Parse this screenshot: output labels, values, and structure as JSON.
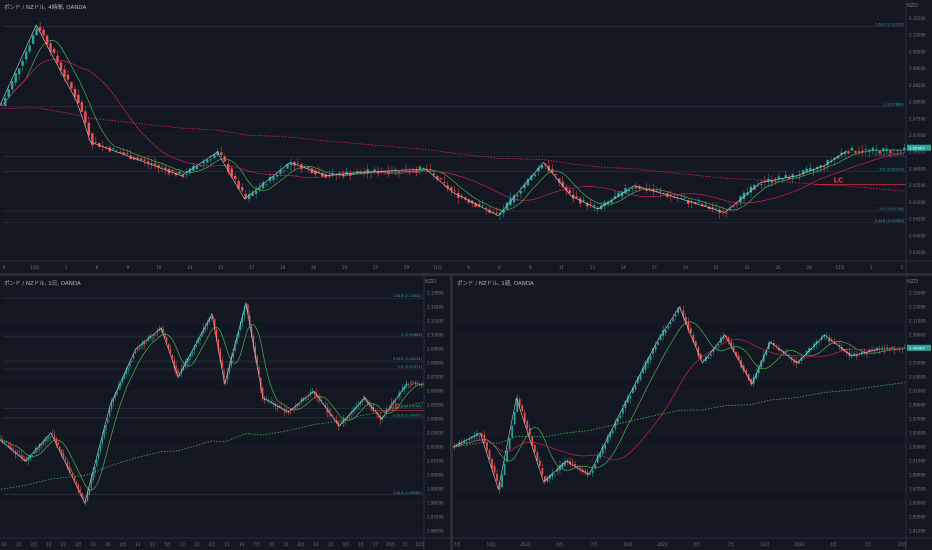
{
  "panes": {
    "top": {
      "title": "ポンド / NZドル, 4時間, OANDA"
    },
    "bl": {
      "title": "ポンド / NZドル, 1日, OANDA"
    },
    "br": {
      "title": "ポンド / NZドル, 1週, OANDA"
    }
  },
  "badge": "NZD",
  "colors": {
    "bg": "#131722",
    "grid": "#1f2430",
    "up": "#26a69a",
    "down": "#ef5350",
    "ma_fast": "#4caf50",
    "ma_slow": "#e91e63",
    "zigzag": "#c9c9c9",
    "lc": "#f23645"
  },
  "chart_data": [
    {
      "type": "candlestick",
      "title": "ポンド / NZドル, 4時間, OANDA",
      "price_labels": [
        "2.10500",
        "2.10000",
        "2.09500",
        "2.09000",
        "2.08500",
        "2.08000",
        "2.07500",
        "2.07000",
        "2.06500",
        "2.06000",
        "2.05500",
        "2.05000",
        "2.04500",
        "2.04000",
        "2.03500"
      ],
      "fib_levels": [
        {
          "label": "1.618 (2.10258)",
          "value": 2.10258
        },
        {
          "label": "1 (2.07866)",
          "value": 2.07866
        },
        {
          "label": "0.618 (2.06378)",
          "value": 2.06378
        },
        {
          "label": "0.5 (2.05919)",
          "value": 2.05919
        },
        {
          "label": "0.5 (2.04744)",
          "value": 2.04744
        },
        {
          "label": "0.618 (2.04390)",
          "value": 2.0439
        }
      ],
      "current_price": "2.05963",
      "annotation": "LC",
      "x_ticks": [
        "9",
        "10月",
        "3",
        "6",
        "9",
        "10",
        "13",
        "15",
        "17",
        "18",
        "20",
        "24",
        "27",
        "29",
        "11月",
        "4",
        "6",
        "8",
        "11",
        "13",
        "14",
        "17",
        "19",
        "21",
        "22",
        "26",
        "28",
        "12月",
        "3",
        "5"
      ]
    },
    {
      "type": "candlestick",
      "title": "ポンド / NZドル, 1日, OANDA",
      "price_labels": [
        "2.13000",
        "2.12000",
        "2.11000",
        "2.10000",
        "2.09000",
        "2.08000",
        "2.07000",
        "2.06000",
        "2.05000",
        "2.04000",
        "2.03000",
        "2.02000",
        "2.01000",
        "2.00000",
        "1.99000",
        "1.98000",
        "1.97000",
        "1.96000"
      ],
      "fib_levels": [
        {
          "label": "1.618 (2.12632)",
          "value": 2.12632
        },
        {
          "label": "1 (2.09863)",
          "value": 2.09863
        },
        {
          "label": "0.618 (2.08134)",
          "value": 2.08134
        },
        {
          "label": "0.5 (2.07571)",
          "value": 2.07571
        },
        {
          "label": "0.5 (2.04746)",
          "value": 2.04746
        },
        {
          "label": "0.618 (2.04095)",
          "value": 2.04095
        },
        {
          "label": "1.618 (1.98589)",
          "value": 1.98589
        }
      ],
      "annotation": "LC",
      "x_ticks": [
        "16",
        "22",
        "2月",
        "13",
        "22",
        "3月",
        "13",
        "24",
        "4月",
        "13",
        "22",
        "5月",
        "13",
        "22",
        "6月",
        "11",
        "19",
        "7月",
        "10",
        "21",
        "8月",
        "13",
        "22",
        "9月",
        "10",
        "17",
        "10月",
        "11",
        "12月"
      ]
    },
    {
      "type": "candlestick",
      "title": "ポンド / NZドル, 1週, OANDA",
      "price_labels": [
        "2.15000",
        "2.13000",
        "2.11000",
        "2.09000",
        "2.07000",
        "2.05000",
        "2.03000",
        "2.01000",
        "1.99000",
        "1.97000",
        "1.95000",
        "1.93000",
        "1.91000",
        "1.89000",
        "1.87000",
        "1.85000",
        "1.83000",
        "1.81000"
      ],
      "current_price": "2.06963",
      "x_ticks": [
        "7月",
        "10月",
        "2022",
        "4月",
        "7月",
        "10月",
        "2023",
        "4月",
        "7月",
        "10月",
        "2024",
        "4月",
        "7月",
        "10月"
      ]
    }
  ]
}
